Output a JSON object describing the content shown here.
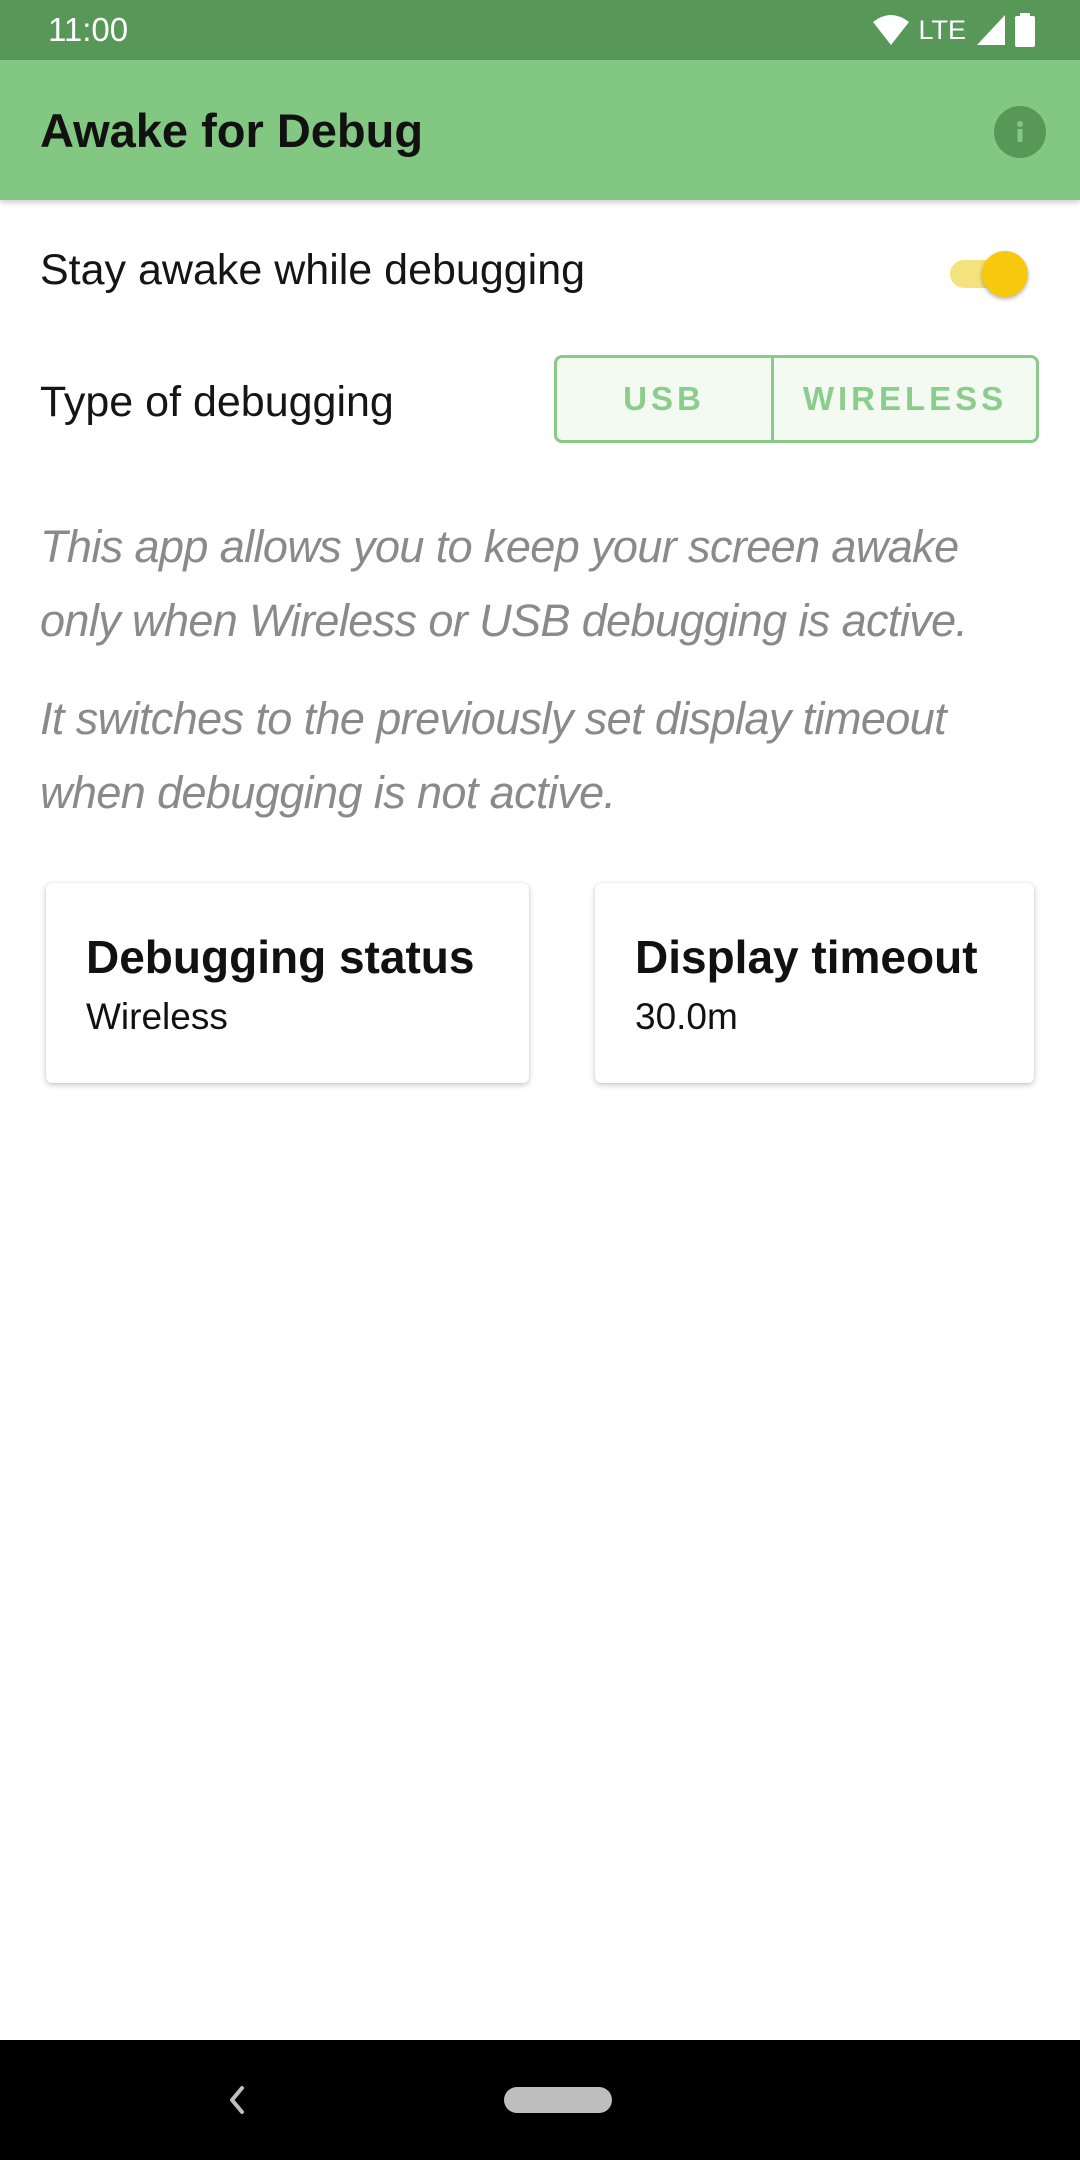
{
  "status_bar": {
    "time": "11:00",
    "network_label": "LTE"
  },
  "app_bar": {
    "title": "Awake for Debug",
    "info_icon": "info-icon"
  },
  "settings": {
    "stay_awake_label": "Stay awake while debugging",
    "stay_awake_enabled": true,
    "debug_type_label": "Type of debugging",
    "debug_type_options": [
      "USB",
      "WIRELESS"
    ]
  },
  "description": {
    "paragraph_1": "This app allows you to keep your screen awake only when Wireless or USB debugging is active.",
    "paragraph_2": "It switches to the previously set display timeout when debugging is not active."
  },
  "cards": {
    "status_title": "Debugging status",
    "status_value": "Wireless",
    "timeout_title": "Display timeout",
    "timeout_value": "30.0m"
  },
  "colors": {
    "status_bar": "#579858",
    "app_bar": "#82c882",
    "accent_switch": "#f6c90e",
    "segment_text": "#8ccd8c",
    "description_text": "#8a8a8a"
  }
}
